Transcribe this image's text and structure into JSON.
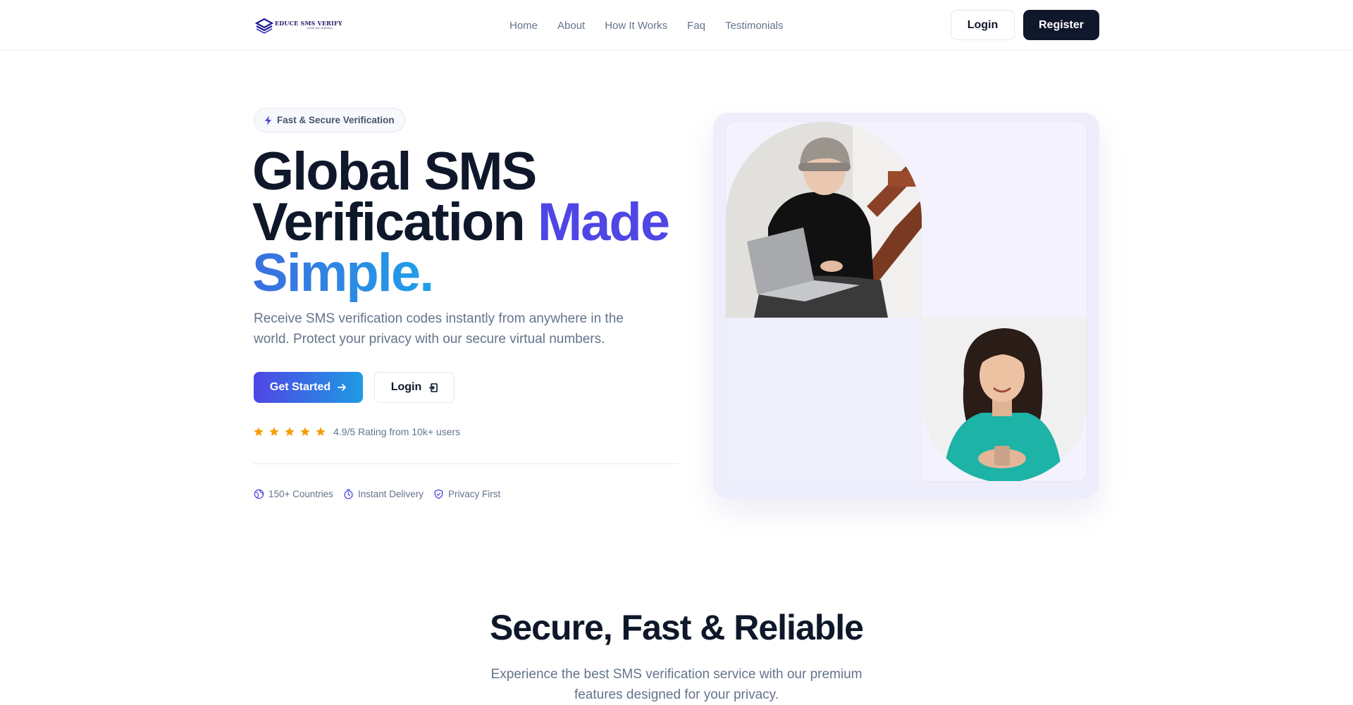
{
  "nav": {
    "logo": {
      "name": "EDUCE SMS VERIFY",
      "tagline": "secure sms verification"
    },
    "links": [
      "Home",
      "About",
      "How It Works",
      "Faq",
      "Testimonials"
    ],
    "login_label": "Login",
    "register_label": "Register"
  },
  "hero": {
    "badge": "Fast & Secure Verification",
    "title_line1": "Global SMS",
    "title_line2": "Verification",
    "title_accent1": "Made",
    "title_accent2": "Simple.",
    "description": "Receive SMS verification codes instantly from anywhere in the world. Protect your privacy with our secure virtual numbers.",
    "cta_primary": "Get Started",
    "cta_secondary": "Login",
    "rating": {
      "stars": 5,
      "text": "4.9/5 Rating from 10k+ users"
    },
    "features": [
      "150+ Countries",
      "Instant Delivery",
      "Privacy First"
    ]
  },
  "section": {
    "title": "Secure, Fast & Reliable",
    "subtitle": "Experience the best SMS verification service with our premium features designed for your privacy."
  },
  "colors": {
    "primary": "#4f46e5",
    "accent": "#1e9be3",
    "dark": "#0f172a",
    "muted": "#64748b",
    "star": "#f59e0b"
  }
}
